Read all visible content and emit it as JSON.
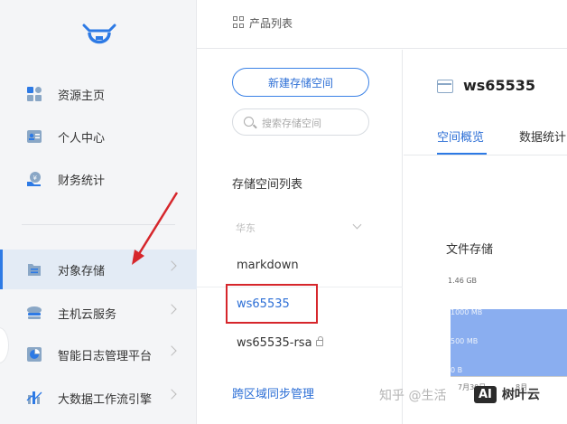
{
  "sidebar": {
    "items": [
      {
        "label": "资源主页",
        "icon": "dashboard-icon"
      },
      {
        "label": "个人中心",
        "icon": "id-card-icon"
      },
      {
        "label": "财务统计",
        "icon": "finance-icon"
      },
      {
        "label": "对象存储",
        "icon": "document-storage-icon"
      },
      {
        "label": "主机云服务",
        "icon": "cloud-server-icon"
      },
      {
        "label": "智能日志管理平台",
        "icon": "pie-chart-icon"
      },
      {
        "label": "大数据工作流引擎",
        "icon": "data-workflow-icon"
      }
    ]
  },
  "topbar": {
    "breadcrumb": "产品列表"
  },
  "storage": {
    "new_button": "新建存储空间",
    "search_placeholder": "搜索存储空间",
    "list_title": "存储空间列表",
    "region": "华东",
    "buckets": [
      "markdown",
      "ws65535",
      "ws65535-rsa"
    ],
    "sync_link": "跨区域同步管理"
  },
  "detail": {
    "bucket_name": "ws65535",
    "tabs": [
      "空间概览",
      "数据统计"
    ],
    "section_title": "文件存储",
    "chart_labels": {
      "top": "1.46 GB",
      "mid1": "1000 MB",
      "mid2": "500 MB",
      "zero": "0 B",
      "x1": "7月30日",
      "x2": "8月"
    }
  },
  "watermark": {
    "text": "知乎 @生活",
    "badge": "AI",
    "badge_text": "树叶云"
  },
  "colors": {
    "accent": "#2d7ae5",
    "highlight": "#d6262b",
    "bar": "#8aaef0"
  }
}
